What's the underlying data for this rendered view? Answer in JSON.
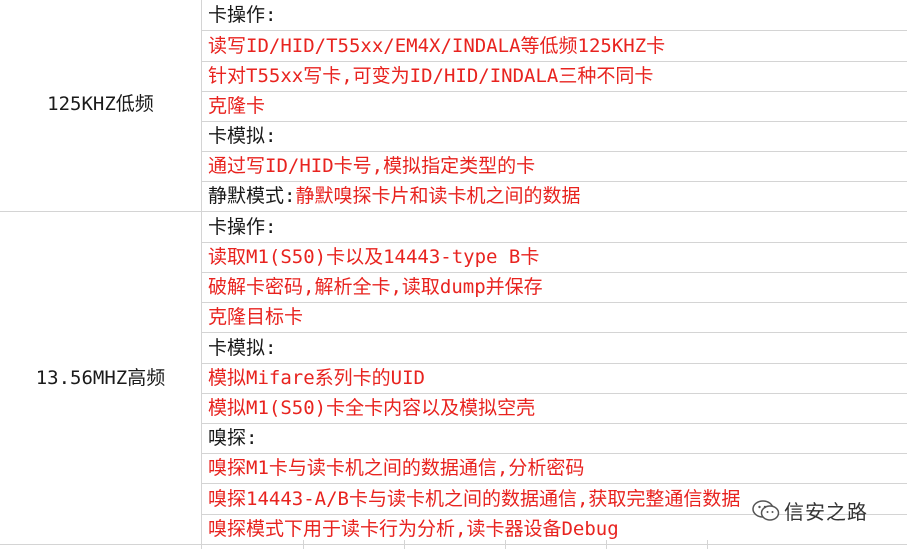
{
  "groups": [
    {
      "label": "125KHZ低频",
      "rows": [
        {
          "text": "卡操作:",
          "color": "black"
        },
        {
          "text": "读写ID/HID/T55xx/EM4X/INDALA等低频125KHZ卡",
          "color": "red"
        },
        {
          "text": "针对T55xx写卡,可变为ID/HID/INDALA三种不同卡",
          "color": "red"
        },
        {
          "text": "克隆卡",
          "color": "red"
        },
        {
          "text": "卡模拟:",
          "color": "black"
        },
        {
          "text": "通过写ID/HID卡号,模拟指定类型的卡",
          "color": "red"
        },
        {
          "prefix": "静默模式:",
          "text": "静默嗅探卡片和读卡机之间的数据",
          "color": "mixed"
        }
      ]
    },
    {
      "label": "13.56MHZ高频",
      "rows": [
        {
          "text": "卡操作:",
          "color": "black"
        },
        {
          "text": "读取M1(S50)卡以及14443-type B卡",
          "color": "red"
        },
        {
          "text": "破解卡密码,解析全卡,读取dump并保存",
          "color": "red"
        },
        {
          "text": "克隆目标卡",
          "color": "red"
        },
        {
          "text": "卡模拟:",
          "color": "black"
        },
        {
          "text": "模拟Mifare系列卡的UID",
          "color": "red"
        },
        {
          "text": "模拟M1(S50)卡全卡内容以及模拟空壳",
          "color": "red"
        },
        {
          "text": "嗅探:",
          "color": "black"
        },
        {
          "text": "嗅探M1卡与读卡机之间的数据通信,分析密码",
          "color": "red"
        },
        {
          "text": "嗅探14443-A/B卡与读卡机之间的数据通信,获取完整通信数据",
          "color": "red"
        },
        {
          "text": "嗅探模式下用于读卡行为分析,读卡器设备Debug",
          "color": "red"
        }
      ]
    }
  ],
  "watermark": {
    "text": "信安之路",
    "icon": "wechat-icon"
  },
  "colors": {
    "red": "#e8231f",
    "black": "#1a1a1a",
    "grid": "#d4d4d4"
  }
}
